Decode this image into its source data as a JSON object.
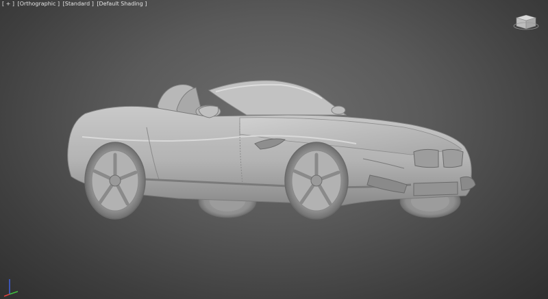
{
  "viewport": {
    "labels": {
      "plus": "[ + ]",
      "view": "[Orthographic ]",
      "render_mode": "[Standard ]",
      "shading": "[Default Shading ]"
    }
  },
  "icons": {
    "viewcube": "viewcube-icon",
    "gizmo": "axis-tripod-icon"
  },
  "colors": {
    "background_center": "#6e6e6e",
    "background_edge": "#2f2f2f",
    "model": "#b4b4b4",
    "axis_x": "#e04040",
    "axis_y": "#40c040",
    "axis_z": "#4060e0"
  }
}
